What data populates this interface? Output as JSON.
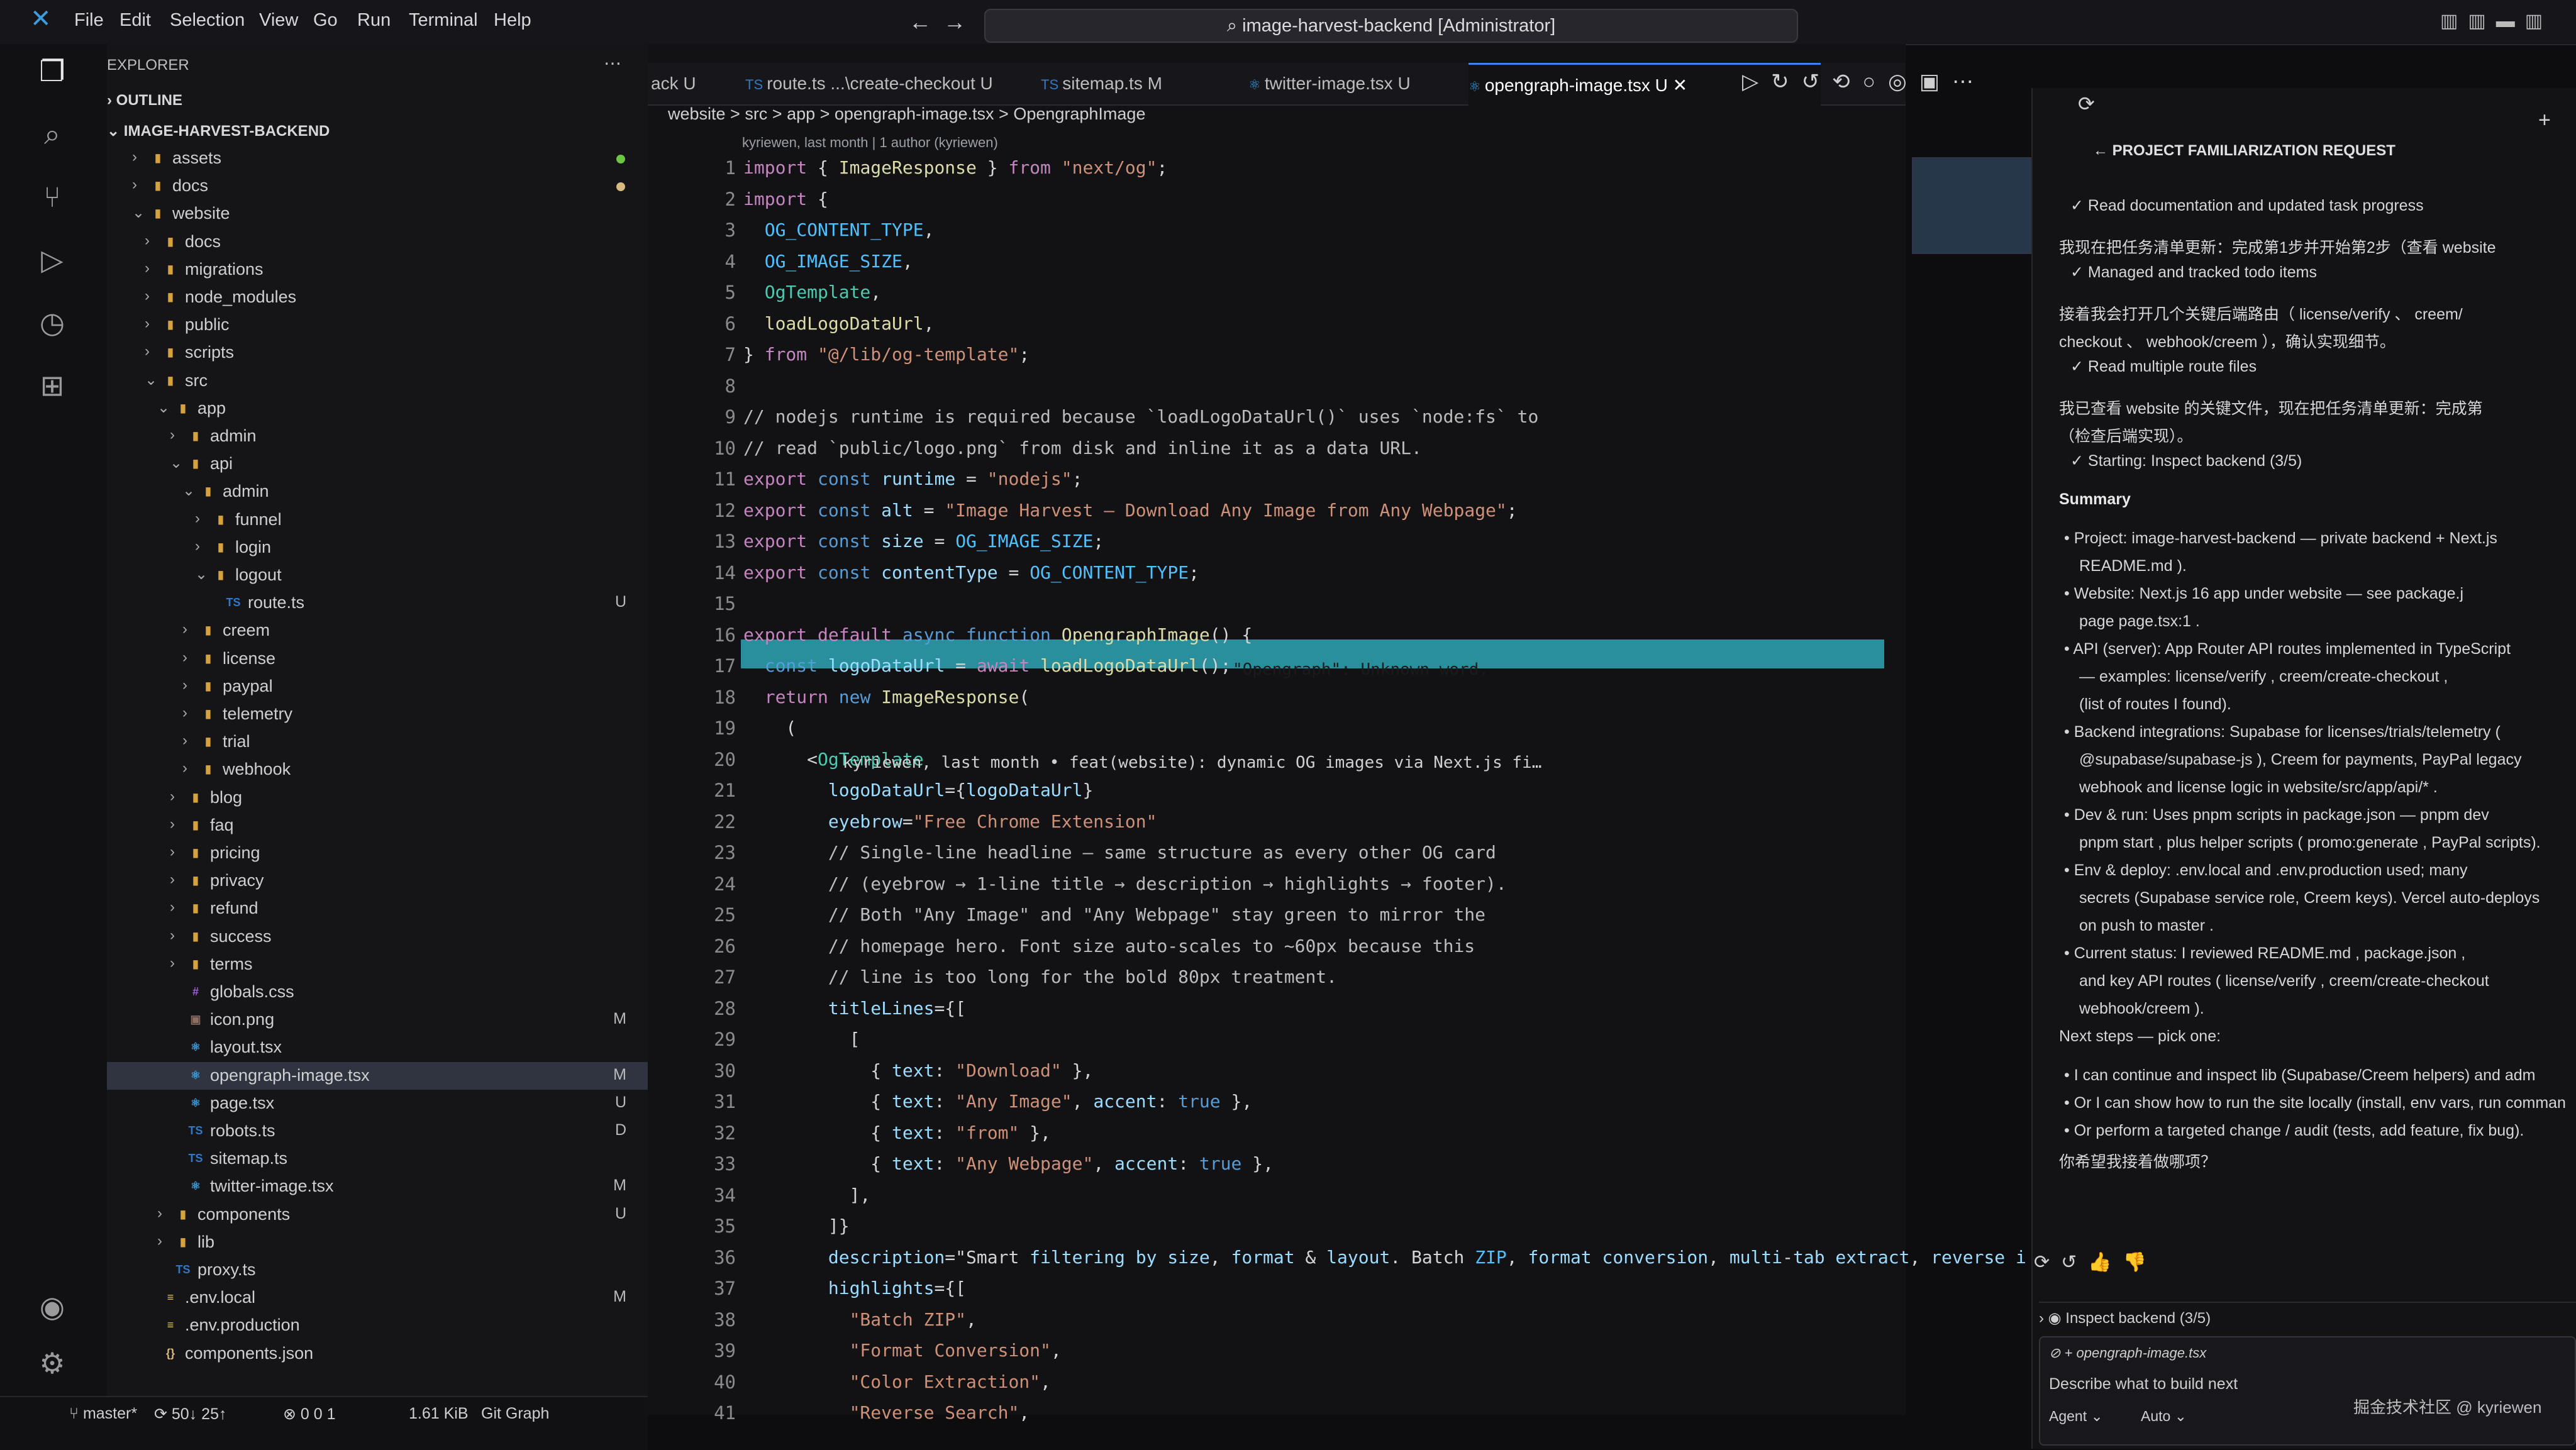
{
  "menu": [
    "File",
    "Edit",
    "Selection",
    "View",
    "Go",
    "Run",
    "Terminal",
    "Help"
  ],
  "command_center": "image-harvest-backend [Administrator]",
  "explorer": {
    "title": "EXPLORER",
    "outline_label": "OUTLINE",
    "root": "IMAGE-HARVEST-BACKEND",
    "rows": [
      {
        "label": "assets",
        "depth": 1,
        "kind": "folder",
        "dot": "#6cc644"
      },
      {
        "label": "docs",
        "depth": 1,
        "kind": "folder",
        "dot": "#d7ba7d"
      },
      {
        "label": "website",
        "depth": 1,
        "kind": "folder-open"
      },
      {
        "label": "docs",
        "depth": 2,
        "kind": "folder"
      },
      {
        "label": "migrations",
        "depth": 2,
        "kind": "folder"
      },
      {
        "label": "node_modules",
        "depth": 2,
        "kind": "folder"
      },
      {
        "label": "public",
        "depth": 2,
        "kind": "folder"
      },
      {
        "label": "scripts",
        "depth": 2,
        "kind": "folder"
      },
      {
        "label": "src",
        "depth": 2,
        "kind": "folder-open"
      },
      {
        "label": "app",
        "depth": 3,
        "kind": "folder-open"
      },
      {
        "label": "admin",
        "depth": 4,
        "kind": "folder"
      },
      {
        "label": "api",
        "depth": 4,
        "kind": "folder-open"
      },
      {
        "label": "admin",
        "depth": 5,
        "kind": "folder-open"
      },
      {
        "label": "funnel",
        "depth": 6,
        "kind": "folder"
      },
      {
        "label": "login",
        "depth": 6,
        "kind": "folder"
      },
      {
        "label": "logout",
        "depth": 6,
        "kind": "folder-open"
      },
      {
        "label": "route.ts",
        "depth": 7,
        "kind": "ts",
        "badge": "U"
      },
      {
        "label": "creem",
        "depth": 5,
        "kind": "folder"
      },
      {
        "label": "license",
        "depth": 5,
        "kind": "folder"
      },
      {
        "label": "paypal",
        "depth": 5,
        "kind": "folder"
      },
      {
        "label": "telemetry",
        "depth": 5,
        "kind": "folder"
      },
      {
        "label": "trial",
        "depth": 5,
        "kind": "folder"
      },
      {
        "label": "webhook",
        "depth": 5,
        "kind": "folder"
      },
      {
        "label": "blog",
        "depth": 4,
        "kind": "folder"
      },
      {
        "label": "faq",
        "depth": 4,
        "kind": "folder"
      },
      {
        "label": "pricing",
        "depth": 4,
        "kind": "folder"
      },
      {
        "label": "privacy",
        "depth": 4,
        "kind": "folder"
      },
      {
        "label": "refund",
        "depth": 4,
        "kind": "folder"
      },
      {
        "label": "success",
        "depth": 4,
        "kind": "folder"
      },
      {
        "label": "terms",
        "depth": 4,
        "kind": "folder"
      },
      {
        "label": "globals.css",
        "depth": 4,
        "kind": "css"
      },
      {
        "label": "icon.png",
        "depth": 4,
        "kind": "png",
        "badge": "M"
      },
      {
        "label": "layout.tsx",
        "depth": 4,
        "kind": "tsx"
      },
      {
        "label": "opengraph-image.tsx",
        "depth": 4,
        "kind": "tsx",
        "badge": "M",
        "selected": true
      },
      {
        "label": "page.tsx",
        "depth": 4,
        "kind": "tsx",
        "badge": "U"
      },
      {
        "label": "robots.ts",
        "depth": 4,
        "kind": "ts",
        "badge": "D"
      },
      {
        "label": "sitemap.ts",
        "depth": 4,
        "kind": "ts"
      },
      {
        "label": "twitter-image.tsx",
        "depth": 4,
        "kind": "tsx",
        "badge": "M"
      },
      {
        "label": "components",
        "depth": 3,
        "kind": "folder",
        "badge": "U"
      },
      {
        "label": "lib",
        "depth": 3,
        "kind": "folder"
      },
      {
        "label": "proxy.ts",
        "depth": 3,
        "kind": "ts"
      },
      {
        "label": ".env.local",
        "depth": 2,
        "kind": "env",
        "badge": "M"
      },
      {
        "label": ".env.production",
        "depth": 2,
        "kind": "env"
      },
      {
        "label": "components.json",
        "depth": 2,
        "kind": "json"
      }
    ]
  },
  "tabs": [
    {
      "label": "ack  U",
      "icon": ""
    },
    {
      "label": "route.ts  ...\\create-checkout  U",
      "icon": "TS"
    },
    {
      "label": "sitemap.ts  M",
      "icon": "TS"
    },
    {
      "label": "twitter-image.tsx  U",
      "icon": "tsx"
    },
    {
      "label": "opengraph-image.tsx  U",
      "icon": "tsx",
      "active": true
    }
  ],
  "breadcrumb": "website  >  src  >  app  >  opengraph-image.tsx  >  OpengraphImage",
  "blame_header": "kyriewen, last month | 1 author (kyriewen)",
  "inline_blame": "kyriewen, last month • feat(website): dynamic OG images via Next.js fi…",
  "hover_diag": "\"Opengraph\": Unknown word.",
  "code_lines": [
    "import { ImageResponse } from \"next/og\";",
    "import {",
    "  OG_CONTENT_TYPE,",
    "  OG_IMAGE_SIZE,",
    "  OgTemplate,",
    "  loadLogoDataUrl,",
    "} from \"@/lib/og-template\";",
    "",
    "// nodejs runtime is required because `loadLogoDataUrl()` uses `node:fs` to",
    "// read `public/logo.png` from disk and inline it as a data URL.",
    "export const runtime = \"nodejs\";",
    "export const alt = \"Image Harvest — Download Any Image from Any Webpage\";",
    "export const size = OG_IMAGE_SIZE;",
    "export const contentType = OG_CONTENT_TYPE;",
    "",
    "export default async function OpengraphImage() {",
    "  const logoDataUrl = await loadLogoDataUrl();",
    "  return new ImageResponse(",
    "    (",
    "      <OgTemplate",
    "        logoDataUrl={logoDataUrl}",
    "        eyebrow=\"Free Chrome Extension\"",
    "        // Single-line headline — same structure as every other OG card",
    "        // (eyebrow → 1-line title → description → highlights → footer).",
    "        // Both \"Any Image\" and \"Any Webpage\" stay green to mirror the",
    "        // homepage hero. Font size auto-scales to ~60px because this",
    "        // line is too long for the bold 80px treatment.",
    "        titleLines={[",
    "          [",
    "            { text: \"Download\" },",
    "            { text: \"Any Image\", accent: true },",
    "            { text: \"from\" },",
    "            { text: \"Any Webpage\", accent: true },",
    "          ],",
    "        ]}",
    "        description=\"Smart filtering by size, format & layout. Batch ZIP, format conversion, multi-tab extract, reverse i",
    "        highlights={[",
    "          \"Batch ZIP\",",
    "          \"Format Conversion\",",
    "          \"Color Extraction\",",
    "          \"Reverse Search\","
  ],
  "chat": {
    "header": "PROJECT FAMILIARIZATION REQUEST",
    "lines": [
      "✓  Read documentation and updated task progress",
      "我现在把任务清单更新：完成第1步并开始第2步（查看  website",
      "✓  Managed and tracked todo items",
      "接着我会打开几个关键后端路由（ license/verify 、 creem/",
      "checkout 、 webhook/creem ），确认实现细节。",
      "✓  Read multiple route files",
      "我已查看  website  的关键文件，现在把任务清单更新：完成第",
      "（检查后端实现）。",
      "✓  Starting: Inspect backend (3/5)",
      "Summary",
      "•  Project: image-harvest-backend — private backend + Next.js",
      "     README.md ).",
      "•  Website: Next.js 16 app under  website — see  package.j",
      "   page  page.tsx:1 .",
      "•  API (server): App Router API routes implemented in TypeScript",
      "   — examples:  license/verify ,  creem/create-checkout ,",
      "   (list of routes I found).",
      "•  Backend integrations: Supabase for licenses/trials/telemetry (",
      "     @supabase/supabase-js ), Creem for payments, PayPal legacy",
      "   webhook and license logic in  website/src/app/api/* .",
      "•  Dev & run: Uses  pnpm  scripts in  package.json  —  pnpm dev",
      "   pnpm start , plus helper scripts ( promo:generate , PayPal scripts).",
      "•  Env & deploy:  .env.local  and  .env.production  used; many",
      "   secrets (Supabase service role, Creem keys). Vercel auto-deploys",
      "   on push to  master .",
      "•  Current status: I reviewed  README.md ,  package.json ,",
      "   and key API routes ( license/verify ,  creem/create-checkout",
      "   webhook/creem ).",
      "Next steps — pick one:",
      "•  I can continue and inspect  lib  (Supabase/Creem helpers) and adm",
      "•  Or I can show how to run the site locally (install, env vars, run comman",
      "•  Or perform a targeted change / audit (tests, add feature, fix bug).",
      "你希望我接着做哪项？"
    ],
    "inspect_row": "Inspect backend (3/5)",
    "context_file": "opengraph-image.tsx",
    "input_placeholder": "Describe what to build next",
    "mode": "Agent",
    "model": "Auto"
  },
  "status": {
    "branch": "master*",
    "sync": "50↓ 25↑",
    "problems": "0  0  1",
    "size": "1.61 KiB",
    "graph": "Git Graph"
  },
  "watermark": "掘金技术社区 @ kyriewen"
}
